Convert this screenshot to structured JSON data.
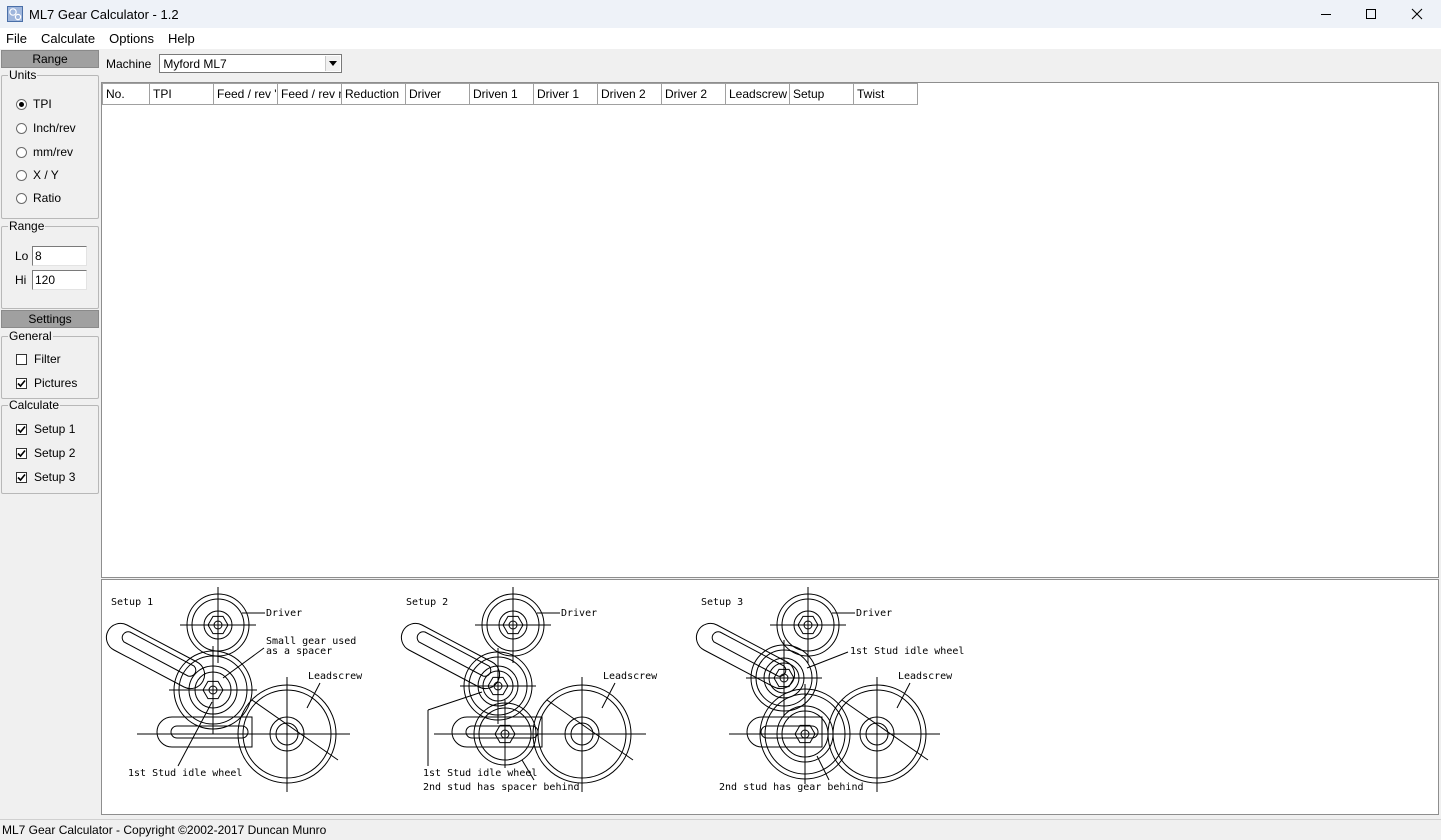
{
  "window": {
    "title": "ML7 Gear Calculator - 1.2"
  },
  "menu": {
    "file": "File",
    "calculate": "Calculate",
    "options": "Options",
    "help": "Help"
  },
  "left": {
    "range_header": "Range",
    "units_legend": "Units",
    "units": [
      "TPI",
      "Inch/rev",
      "mm/rev",
      "X / Y",
      "Ratio"
    ],
    "units_selected": "TPI",
    "range_legend": "Range",
    "lo_label": "Lo",
    "lo_value": "8",
    "hi_label": "Hi",
    "hi_value": "120",
    "settings_header": "Settings",
    "general_legend": "General",
    "filter_label": "Filter",
    "filter_checked": false,
    "pictures_label": "Pictures",
    "pictures_checked": true,
    "calculate_legend": "Calculate",
    "setup1_label": "Setup 1",
    "setup2_label": "Setup 2",
    "setup3_label": "Setup 3"
  },
  "machine": {
    "label": "Machine",
    "value": "Myford ML7"
  },
  "table": {
    "columns": [
      "No.",
      "TPI",
      "Feed / rev \"",
      "Feed / rev mm",
      "Reduction",
      "Driver",
      "Driven 1",
      "Driver 1",
      "Driven 2",
      "Driver 2",
      "Leadscrew",
      "Setup",
      "Twist"
    ],
    "rows": []
  },
  "pictures": {
    "setup1": {
      "title": "Setup 1",
      "driver": "Driver",
      "spacer1": "Small gear used",
      "spacer2": "as a spacer",
      "leadscrew": "Leadscrew",
      "idle": "1st Stud idle wheel"
    },
    "setup2": {
      "title": "Setup 2",
      "driver": "Driver",
      "leadscrew": "Leadscrew",
      "idle": "1st Stud idle wheel",
      "note": "2nd stud has spacer behind"
    },
    "setup3": {
      "title": "Setup 3",
      "driver": "Driver",
      "idle": "1st Stud idle wheel",
      "leadscrew": "Leadscrew",
      "note": "2nd stud has gear behind"
    }
  },
  "status": {
    "text": "ML7 Gear Calculator - Copyright ©2002-2017 Duncan Munro"
  }
}
